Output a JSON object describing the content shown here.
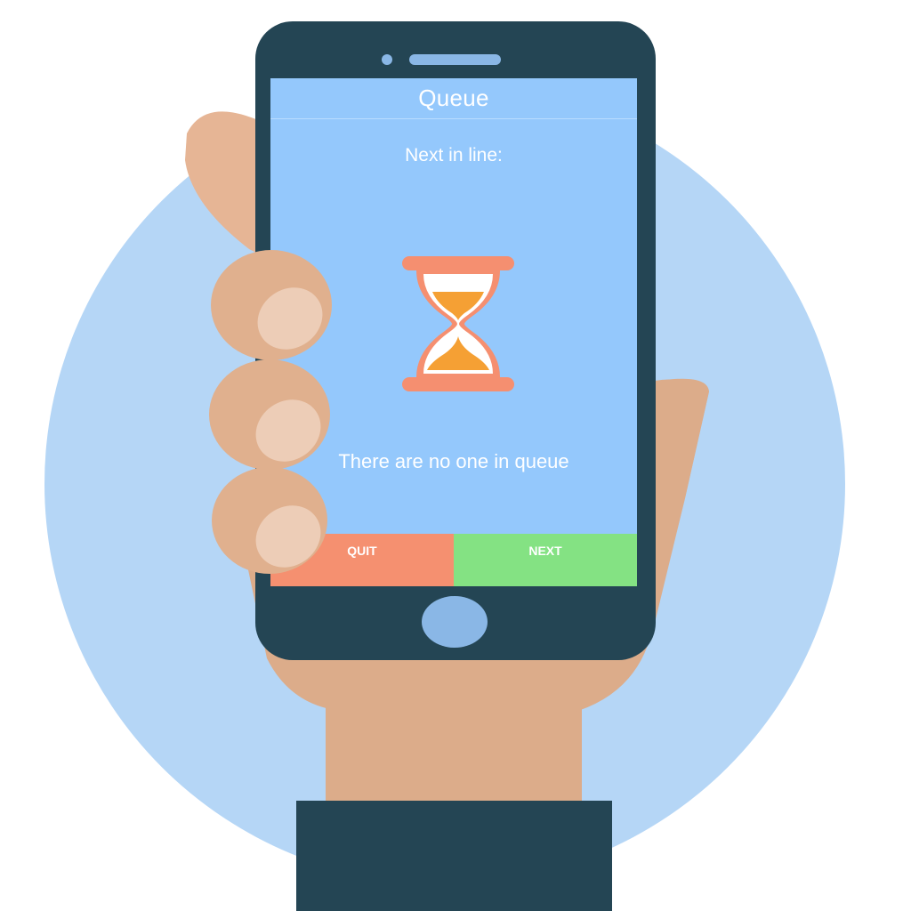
{
  "app": {
    "title": "Queue",
    "next_label": "Next in line:",
    "empty_message": "There are no one in queue"
  },
  "buttons": {
    "quit_label": "QUIT",
    "next_label": "NEXT"
  },
  "icons": {
    "status_icon": "hourglass-icon",
    "home": "home-button-icon"
  },
  "colors": {
    "screen_bg": "#94c8fc",
    "quit": "#f59070",
    "next": "#84e283",
    "phone_body": "#244554",
    "hand": "#dcac8a",
    "circle": "#b5d6f6"
  }
}
